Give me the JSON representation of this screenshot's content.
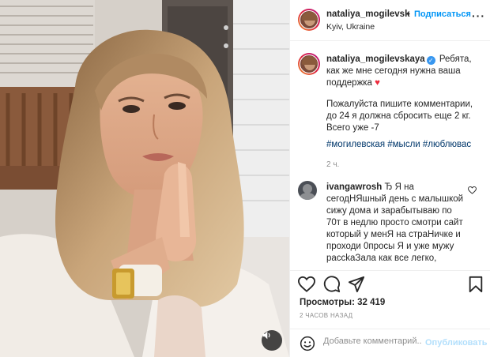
{
  "post": {
    "header": {
      "username": "nataliya_mogilevsk",
      "dot": "•",
      "follow_label": "Подписаться",
      "location": "Kyiv, Ukraine",
      "more": "···"
    },
    "caption": {
      "username": "nataliya_mogilevskaya",
      "verified_mark": "✓",
      "text1": "Ребята, как же мне сегодня нужна ваша поддержка",
      "heart": "♥",
      "text2": "Пожалуйста пишите комментарии, до 24 я должна сбросить еще 2 кг. Всего уже -7",
      "hashtags": "#могилевская #мысли #люблювас",
      "time": "2 ч."
    },
    "comment": {
      "username": "ivangawrosh",
      "text": "Ђ Я на сегодНЯшный день с малышкой сижу дома и зарабытываю по 70т в недлю просто смотри сайт который у менЯ на страНичке и проходи 0просы Я и уже мужу рассkаЗала как все легко,"
    },
    "likes": "Просмотры: 32 419",
    "posted": "2 ЧАСОВ НАЗАД",
    "add_comment_placeholder": "Добавьте комментарий...",
    "publish_label": "Опубликовать"
  },
  "icons": [
    "heart-icon",
    "comment-icon",
    "share-icon",
    "bookmark-icon",
    "emoji-icon",
    "sound-icon",
    "more-icon",
    "verified-icon"
  ],
  "colors": {
    "accent": "#0095f6",
    "heart": "#ed2b3d",
    "hashtag": "#00376b",
    "muted": "#8e8e8e",
    "publish_disabled": "#b2dffc"
  }
}
